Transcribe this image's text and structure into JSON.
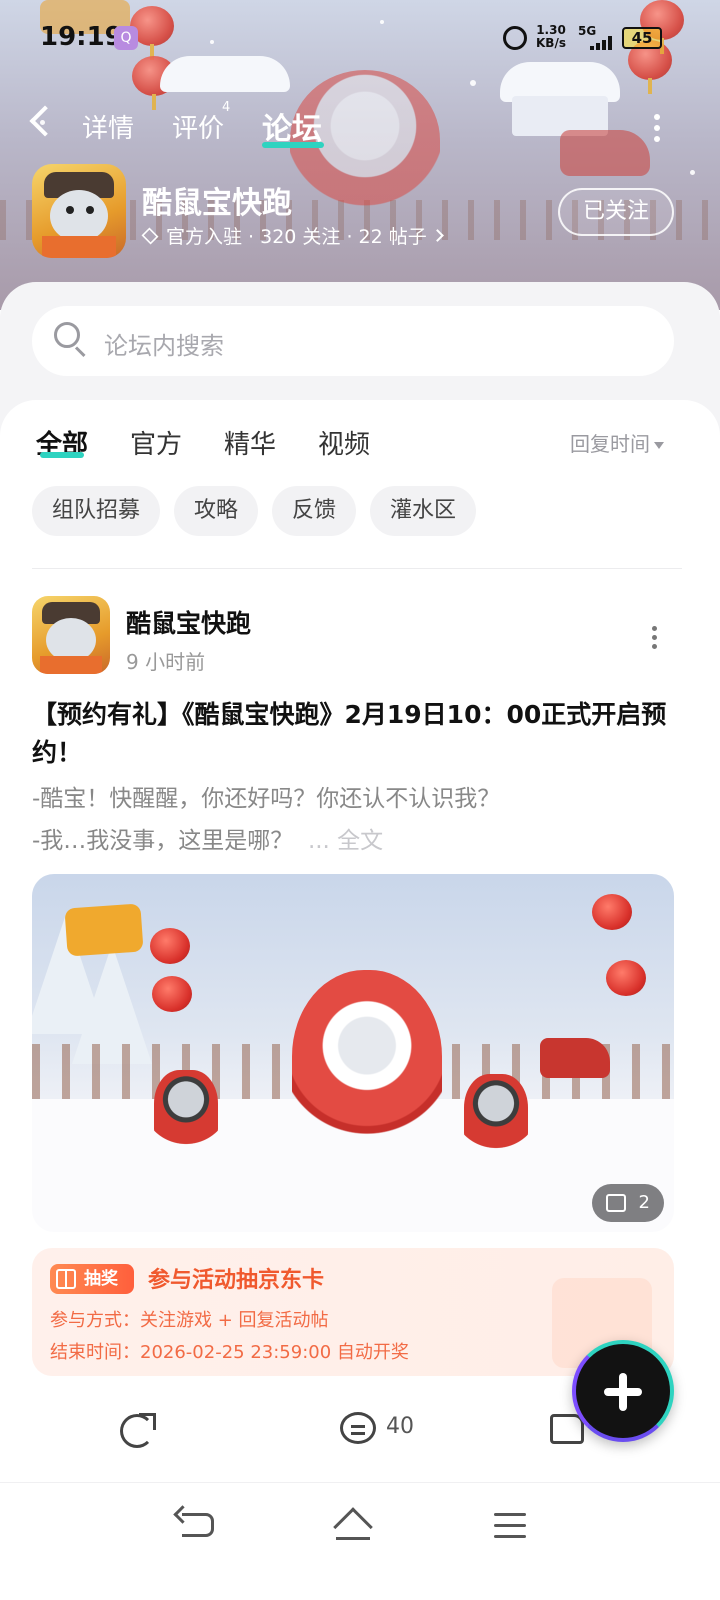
{
  "status_bar": {
    "time": "19:19",
    "speed_value": "1.30",
    "speed_unit": "KB/s",
    "network": "5G",
    "battery": "45"
  },
  "nav": {
    "tabs": [
      {
        "label": "详情"
      },
      {
        "label": "评价",
        "badge": "4"
      },
      {
        "label": "论坛"
      }
    ],
    "active_tab": "论坛",
    "accent_color": "#2ed3c0"
  },
  "app": {
    "name": "酷鼠宝快跑",
    "meta": "官方入驻 · 320 关注 · 22 帖子",
    "follow_label": "已关注"
  },
  "search": {
    "placeholder": "论坛内搜索"
  },
  "filter": {
    "tabs": [
      "全部",
      "官方",
      "精华",
      "视频"
    ],
    "active": "全部",
    "sort_label": "回复时间"
  },
  "chips": [
    "组队招募",
    "攻略",
    "反馈",
    "灌水区"
  ],
  "post": {
    "author": "酷鼠宝快跑",
    "time": "9 小时前",
    "title": "【预约有礼】《酷鼠宝快跑》2月19日10：00正式开启预约！",
    "excerpt_line1": "-酷宝！快醒醒，你还好吗？你还认不认识我？",
    "excerpt_line2": "-我…我没事，这里是哪？",
    "read_more": "... 全文",
    "image_count": "2",
    "lottery": {
      "tag": "抽奖",
      "title": "参与活动抽京东卡",
      "method": "参与方式：关注游戏 + 回复活动帖",
      "end_time": "结束时间：2026-02-25 23:59:00 自动开奖"
    },
    "comment_count": "40"
  }
}
